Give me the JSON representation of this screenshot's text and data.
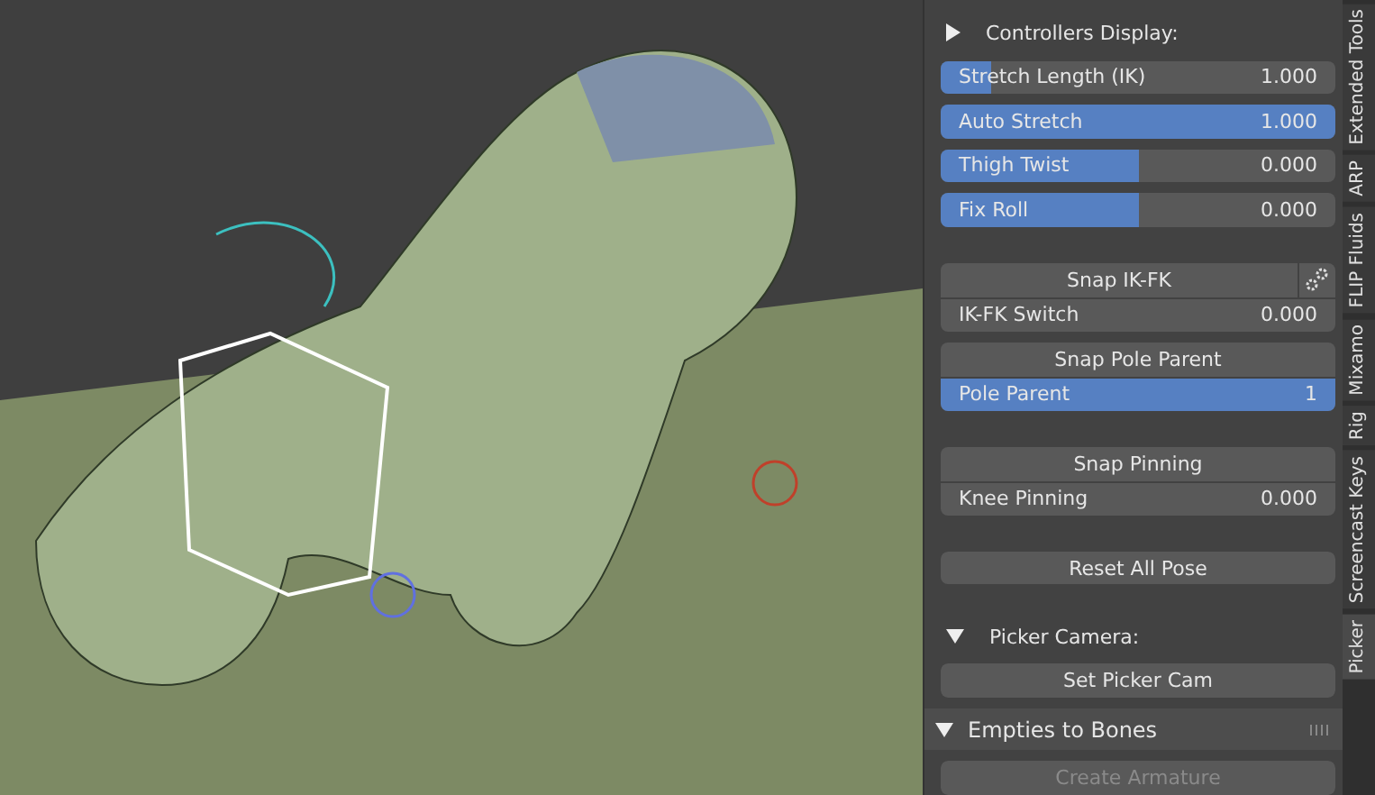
{
  "viewport": {
    "kind": "scene"
  },
  "panel": {
    "sections": [
      {
        "kind": "header",
        "label": "Controllers Display:",
        "expanded": false
      },
      {
        "kind": "slider",
        "label": "Stretch Length (IK)",
        "reading": "1.000",
        "level": 0.13
      },
      {
        "kind": "slider",
        "label": "Auto Stretch",
        "reading": "1.000",
        "level": 1
      },
      {
        "kind": "slider",
        "label": "Thigh Twist",
        "reading": "0.000",
        "level": 0.5
      },
      {
        "kind": "slider",
        "label": "Fix Roll",
        "reading": "0.000",
        "level": 0.5
      },
      {
        "kind": "gap"
      },
      {
        "kind": "button",
        "label": "Snap IK-FK",
        "settings": true
      },
      {
        "kind": "slider",
        "label": "IK-FK Switch",
        "reading": "0.000",
        "level": 0,
        "joined": true
      },
      {
        "kind": "button",
        "label": "Snap Pole Parent"
      },
      {
        "kind": "slider",
        "label": "Pole Parent",
        "reading": "1",
        "level": 1,
        "joined": true
      },
      {
        "kind": "gap"
      },
      {
        "kind": "button",
        "label": "Snap Pinning"
      },
      {
        "kind": "slider",
        "label": "Knee Pinning",
        "reading": "0.000",
        "level": 0,
        "joined": true
      },
      {
        "kind": "gap"
      },
      {
        "kind": "button",
        "label": "Reset All Pose"
      },
      {
        "kind": "gap"
      },
      {
        "kind": "header",
        "label": "Picker Camera:",
        "expanded": true
      },
      {
        "kind": "button",
        "label": "Set Picker Cam"
      },
      {
        "kind": "subpanel",
        "label": "Empties to Bones",
        "expanded": true
      },
      {
        "kind": "button",
        "label": "Create Armature",
        "disabled": true
      }
    ]
  },
  "tabs": [
    {
      "label": "Extended Tools",
      "selected": false
    },
    {
      "label": "ARP",
      "selected": false
    },
    {
      "label": "FLIP Fluids",
      "selected": false
    },
    {
      "label": "Mixamo",
      "selected": false
    },
    {
      "label": "Rig",
      "selected": false
    },
    {
      "label": "Screencast Keys",
      "selected": false
    },
    {
      "label": "Picker",
      "selected": true
    }
  ]
}
